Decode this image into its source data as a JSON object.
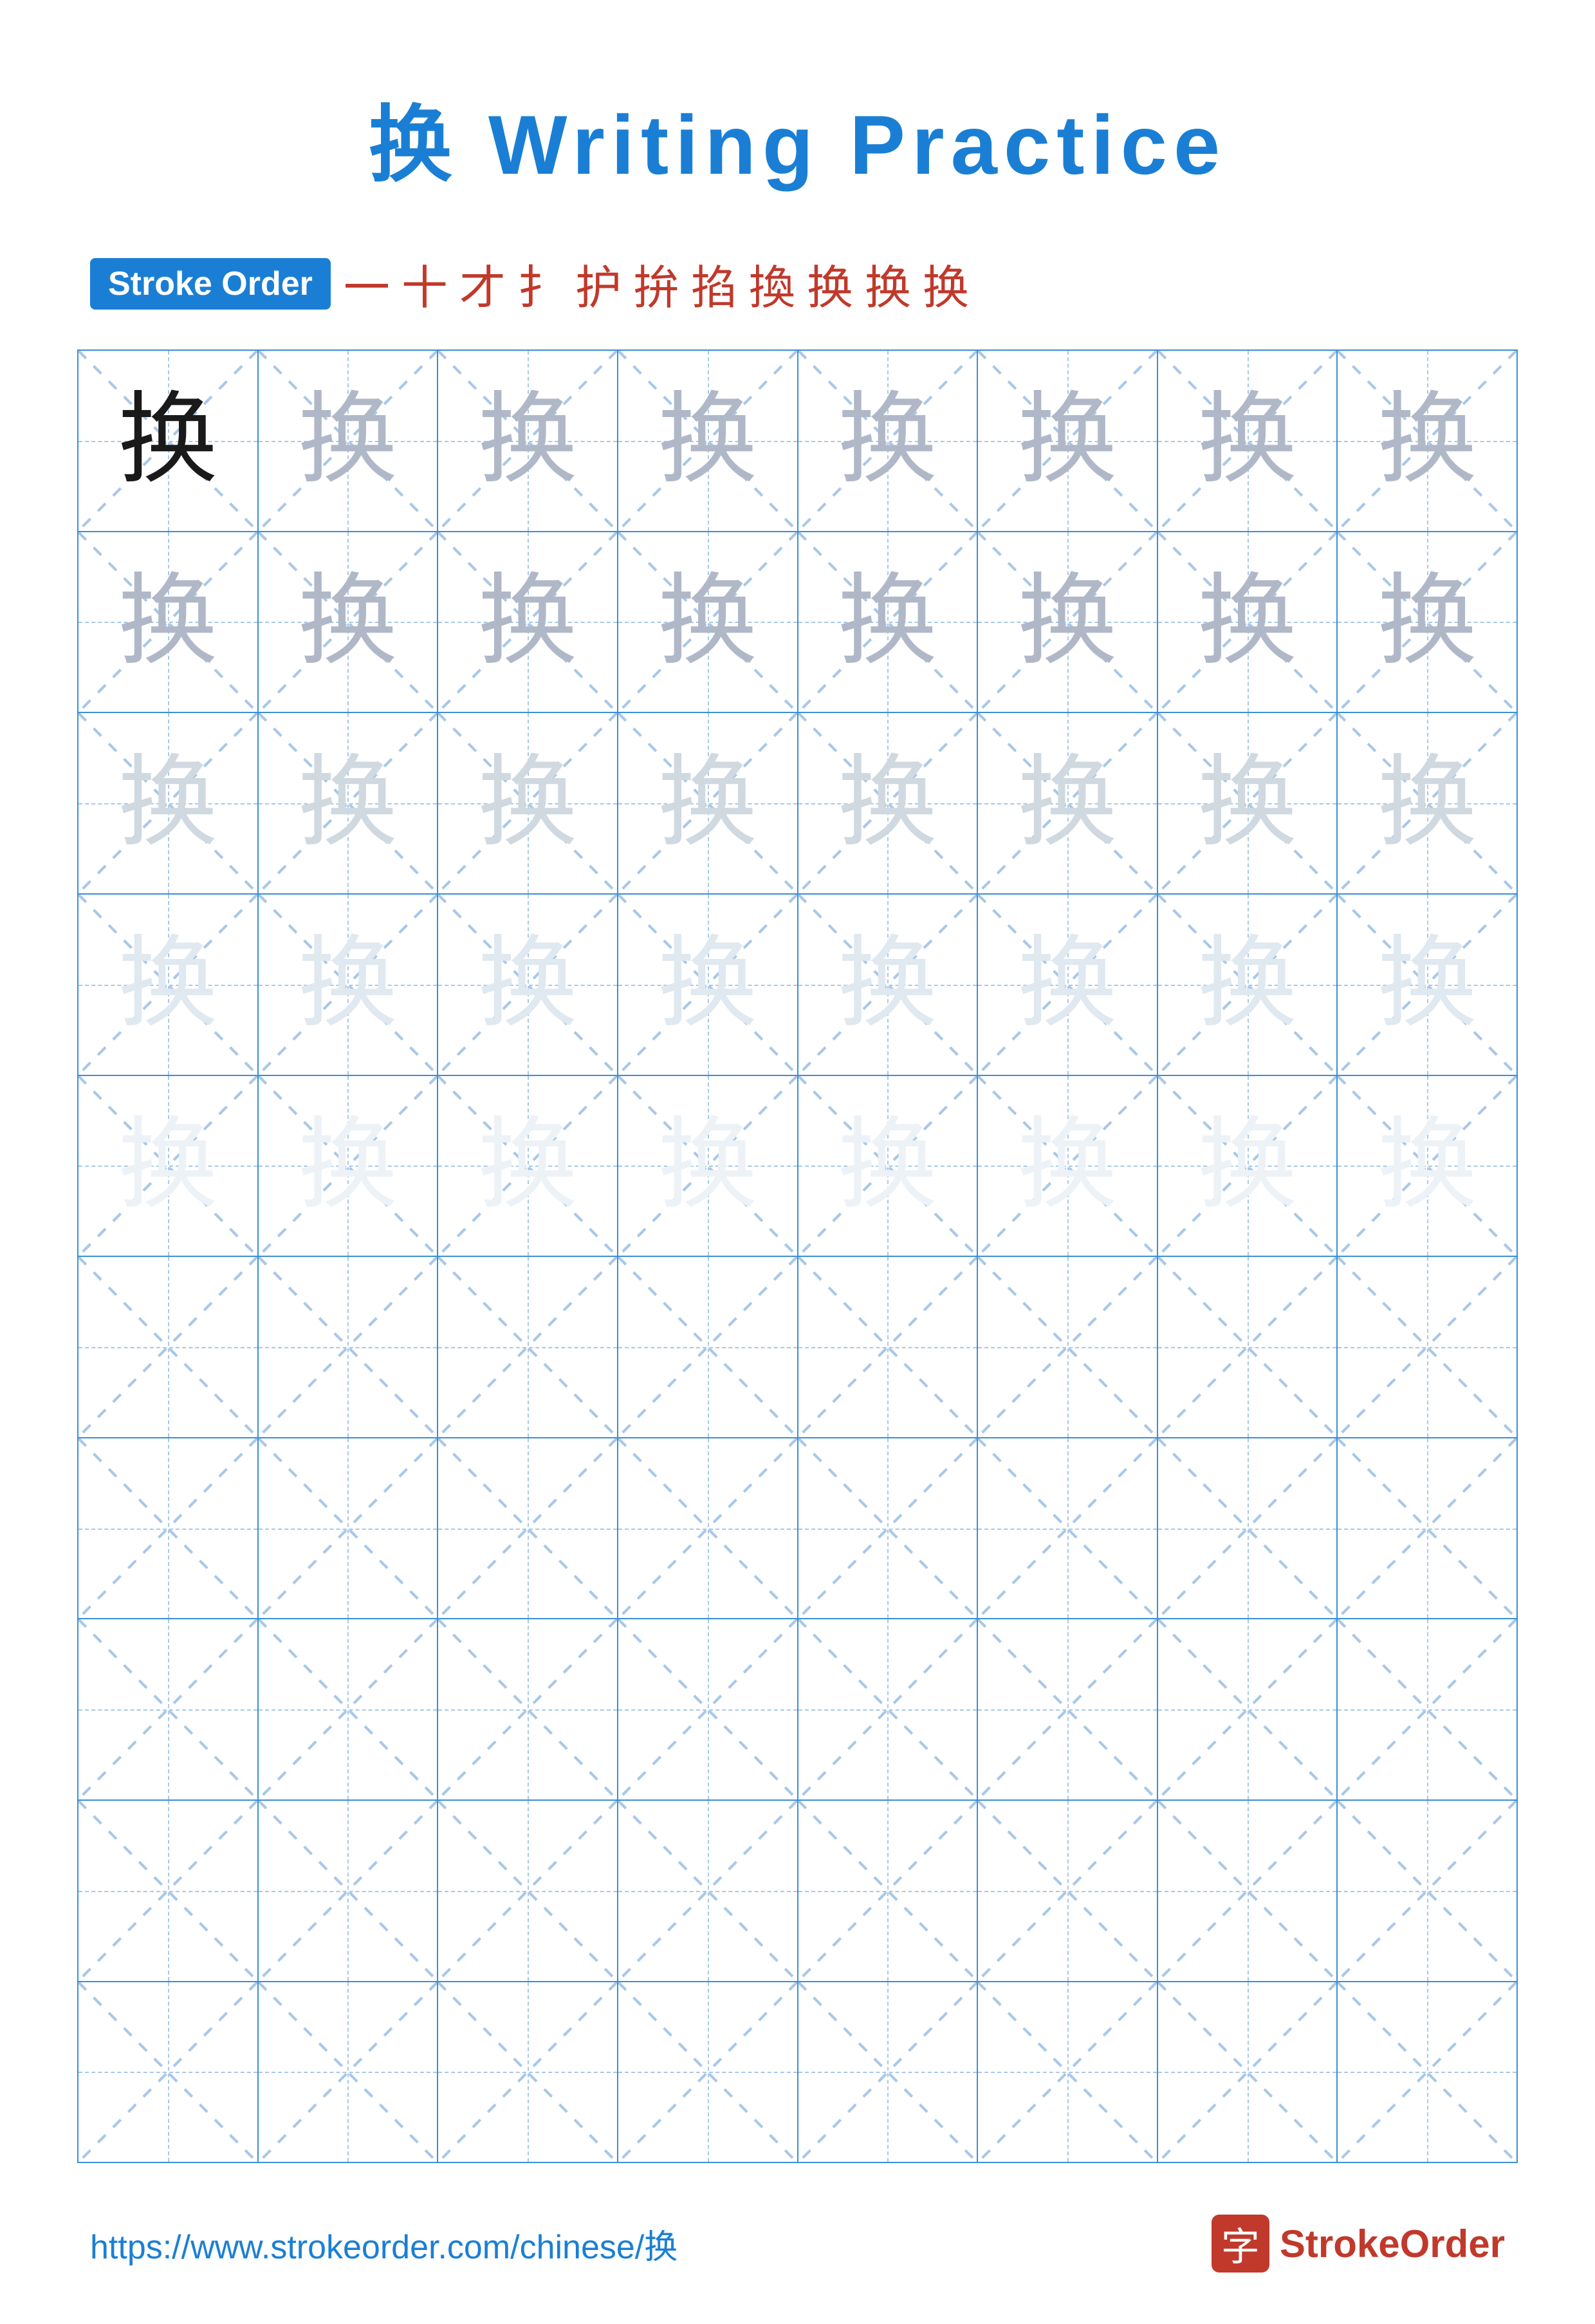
{
  "title": {
    "char": "换",
    "text": " Writing Practice"
  },
  "stroke_order": {
    "badge_label": "Stroke Order",
    "sequence": [
      "一",
      "十",
      "才",
      "扌",
      "扌",
      "护",
      "扸",
      "换",
      "换",
      "换",
      "换"
    ]
  },
  "grid": {
    "rows": 10,
    "cols": 8,
    "character": "换",
    "filled_rows": 5,
    "row_opacities": [
      "dark",
      "medium",
      "medium",
      "light",
      "vlight"
    ]
  },
  "footer": {
    "url": "https://www.strokeorder.com/chinese/换",
    "logo_char": "字",
    "logo_name": "StrokeOrder"
  }
}
